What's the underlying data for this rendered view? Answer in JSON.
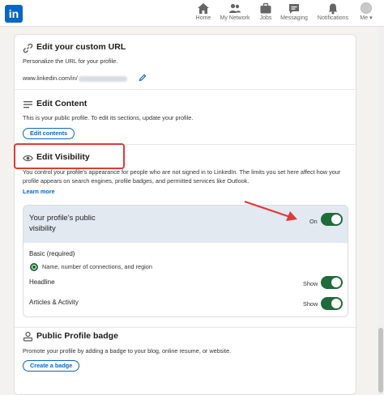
{
  "nav": {
    "logo": "in",
    "items": [
      {
        "label": "Home"
      },
      {
        "label": "My Network"
      },
      {
        "label": "Jobs"
      },
      {
        "label": "Messaging"
      },
      {
        "label": "Notifications"
      },
      {
        "label": "Me"
      }
    ]
  },
  "url_section": {
    "title": "Edit your custom URL",
    "description": "Personalize the URL for your profile.",
    "url_prefix": "www.linkedin.com/in/"
  },
  "content_section": {
    "title": "Edit Content",
    "description": "This is your public profile. To edit its sections, update your profile.",
    "button": "Edit contents"
  },
  "visibility_section": {
    "title": "Edit Visibility",
    "description": "You control your profile's appearance for people who are not signed in to LinkedIn. The limits you set here affect how your profile appears on search engines, profile badges, and permitted services like Outlook.",
    "learn_more": "Learn more",
    "panel": {
      "header": "Your profile's public visibility",
      "header_toggle_label": "On",
      "header_toggle_on": true,
      "basic_label": "Basic (required)",
      "basic_detail": "Name, number of connections, and region",
      "rows": [
        {
          "label": "Headline",
          "toggle_label": "Show",
          "on": true
        },
        {
          "label": "Articles & Activity",
          "toggle_label": "Show",
          "on": true
        }
      ]
    }
  },
  "badge_section": {
    "title": "Public Profile badge",
    "description": "Promote your profile by adding a badge to your blog, online resume, or website.",
    "button": "Create a badge"
  },
  "colors": {
    "brand": "#0a66c2",
    "toggle_on": "#1f6b3a",
    "annotation": "#e03a3a"
  }
}
